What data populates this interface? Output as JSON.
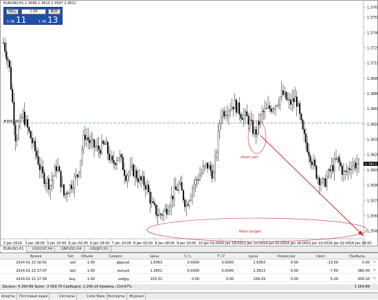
{
  "chart": {
    "symbol_label": "EURUSD,H1  1.3599 1.3613 1.3597 1.3611",
    "y_labels": [
      "1.3765",
      "1.3755",
      "1.3740",
      "1.3725",
      "1.3710",
      "1.3695",
      "1.3680",
      "1.3665",
      "1.3650",
      "1.3635",
      "1.3620",
      "1.3605",
      "1.3590",
      "1.3575",
      "1.3560",
      "1.3545"
    ],
    "current_price": "1.3611",
    "level_label": "#3651369 sell",
    "x_labels": [
      "2 Jan 2014",
      "2 Jan 18:00",
      "3 Jan 10:00",
      "6 Jan 02:00",
      "6 Jan 18:00",
      "7 Jan 10:00",
      "8 Jan 02:00",
      "8 Jan 18:00",
      "9 Jan 10:00",
      "10 Jan 02:00",
      "10 Jan 18:00",
      "13 Jan 10:00",
      "14 Jan 02:00",
      "14 Jan 18:00",
      "15 Jan 10:00",
      "16 Jan 02:00",
      "16 Jan 18:00"
    ],
    "annotation_short": "short sell",
    "annotation_target": "Main target",
    "colors": {
      "candle": "#000000",
      "level": "#2e8b57",
      "annotation": "#cc2222",
      "axis": "#888888"
    }
  },
  "trade_panel": {
    "sell_label": "SELL",
    "buy_label": "BUY",
    "lot_value": "1.00",
    "sell_small": "1.36",
    "sell_big": "11",
    "buy_small": "1.36",
    "buy_big": "13"
  },
  "chart_tabs": [
    "EURUSD,H1",
    "USDCHF,H4",
    "GBPUSD,H4",
    "USDJPY,H1"
  ],
  "terminal": {
    "headers": [
      "Время",
      "Тип",
      "Объём",
      "Символ",
      "Цена",
      "S / L",
      "T / P",
      "Цена",
      "Комиссия",
      "Своп",
      "Прибыль"
    ],
    "rows": [
      [
        "2014.01.13 16:01",
        "sell",
        "1.00",
        "gbpusd",
        "1.6363",
        "0.0000",
        "0.0000",
        "1.6363",
        "0.00",
        "-13.00",
        "0.00"
      ],
      [
        "2014.01.13 17:07",
        "sell",
        "1.00",
        "eurusd",
        "1.3651",
        "0.0000",
        "0.0000",
        "1.3613",
        "0.00",
        "-7.50",
        "380.00"
      ],
      [
        "2014.01.13 17:39",
        "buy",
        "1.00",
        "usdjpy",
        "103.32",
        "0.00",
        "0.00",
        "104.29",
        "0.00",
        "5.29",
        "930.10"
      ]
    ],
    "balance": "Баланс: 4 294.89  Залог: 2 000.70  Свободно: 2 294.19  Уровень: 214.67%",
    "total_profit": "1 294.89"
  },
  "bottom_tabs": [
    "Алерты",
    "Почтовый ящик",
    "Сигналы",
    "Code Base",
    "Эксперты",
    "Журнал"
  ]
}
